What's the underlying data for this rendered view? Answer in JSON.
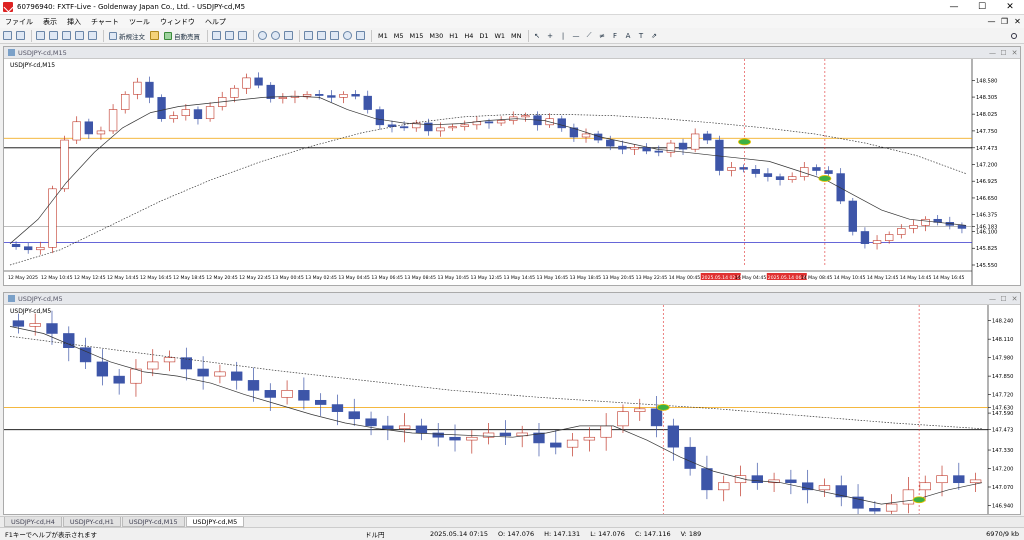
{
  "window": {
    "title": "60796940: FXTF-Live - Goldenway Japan Co., Ltd. - USDJPY-cd,M5",
    "minimize": "—",
    "maximize": "☐",
    "close": "✕"
  },
  "menu": [
    "ファイル",
    "表示",
    "挿入",
    "チャート",
    "ツール",
    "ウィンドウ",
    "ヘルプ"
  ],
  "menu_controls": [
    "—",
    "❐",
    "✕"
  ],
  "toolbar": {
    "new_order": "新規注文",
    "auto_trade": "自動売買",
    "timeframes": [
      "M1",
      "M5",
      "M15",
      "M30",
      "H1",
      "H4",
      "D1",
      "W1",
      "MN"
    ]
  },
  "colors": {
    "bull": "#ffffff",
    "bear": "#3d55a8",
    "bull_top": "#c0392b",
    "ma": "#333333",
    "orange": "#f0a000",
    "blue": "#3333cc",
    "black_line": "#000000",
    "marker": "#3cb043"
  },
  "top_chart": {
    "window_title": "USDJPY-cd,M15",
    "label": "USDJPY-cd,M15",
    "price_labels": [
      "148.580",
      "148.305",
      "148.025",
      "147.750",
      "147.473",
      "147.200",
      "146.925",
      "146.650",
      "146.375",
      "146.183",
      "146.100",
      "145.825",
      "145.550"
    ],
    "orange_level": "147.630",
    "black_level": "147.473",
    "grey_level": "146.183",
    "blue_level": "145.917",
    "time_labels": [
      "12 May 2025",
      "12 May 10:45",
      "12 May 12:45",
      "12 May 14:45",
      "12 May 16:45",
      "12 May 18:45",
      "12 May 20:45",
      "12 May 22:45",
      "13 May 00:45",
      "13 May 02:45",
      "13 May 04:45",
      "13 May 06:45",
      "13 May 08:45",
      "13 May 10:45",
      "13 May 12:45",
      "13 May 14:45",
      "13 May 16:45",
      "13 May 18:45",
      "13 May 20:45",
      "13 May 22:45",
      "14 May 00:45",
      "2025.05.14 02:55",
      "14 May 04:45",
      "2025.05.14 06:40",
      "14 May 08:45",
      "14 May 10:45",
      "14 May 12:45",
      "14 May 14:45",
      "14 May 16:45"
    ],
    "closes": [
      145.85,
      145.8,
      145.84,
      146.8,
      147.6,
      147.9,
      147.7,
      147.75,
      148.1,
      148.35,
      148.55,
      148.3,
      147.95,
      148.0,
      148.1,
      147.95,
      148.15,
      148.3,
      148.45,
      148.62,
      148.5,
      148.28,
      148.3,
      148.32,
      148.35,
      148.33,
      148.3,
      148.35,
      148.32,
      148.1,
      147.85,
      147.82,
      147.8,
      147.88,
      147.75,
      147.8,
      147.82,
      147.85,
      147.9,
      147.88,
      147.92,
      147.98,
      148.0,
      147.85,
      147.95,
      147.8,
      147.65,
      147.7,
      147.6,
      147.5,
      147.45,
      147.48,
      147.42,
      147.4,
      147.55,
      147.45,
      147.7,
      147.6,
      147.1,
      147.15,
      147.12,
      147.05,
      147.0,
      146.95,
      147.0,
      147.15,
      147.1,
      147.05,
      146.6,
      146.1,
      145.9,
      145.95,
      146.05,
      146.15,
      146.2,
      146.3,
      146.25,
      146.2,
      146.15
    ],
    "ma_fast": [
      145.9,
      146.3,
      146.9,
      147.4,
      147.8,
      148.05,
      148.15,
      148.2,
      148.25,
      148.3,
      148.32,
      148.3,
      148.1,
      147.95,
      147.88,
      147.85,
      147.87,
      147.92,
      147.95,
      147.92,
      147.8,
      147.65,
      147.55,
      147.45,
      147.4,
      147.35,
      147.3,
      147.25,
      147.1,
      146.95,
      146.7,
      146.45,
      146.3,
      146.25,
      146.2
    ],
    "ma_slow": [
      145.55,
      145.8,
      146.2,
      146.6,
      146.95,
      147.25,
      147.5,
      147.72,
      147.88,
      147.98,
      148.02,
      148.02,
      148.0,
      147.95,
      147.88,
      147.8,
      147.7,
      147.55,
      147.35,
      147.05
    ],
    "markers": [
      "2025.05.14 02:55",
      "2025.05.14 06:40"
    ]
  },
  "bottom_chart": {
    "window_title": "USDJPY-cd,M5",
    "label": "USDJPY-cd,M5",
    "price_labels": [
      "148.240",
      "148.110",
      "147.980",
      "147.850",
      "147.720",
      "147.630",
      "147.590",
      "147.473",
      "147.330",
      "147.200",
      "147.070",
      "146.940"
    ],
    "orange_level": "147.630",
    "black_level": "147.473",
    "closes": [
      148.2,
      148.22,
      148.15,
      148.05,
      147.95,
      147.85,
      147.8,
      147.9,
      147.95,
      147.98,
      147.9,
      147.85,
      147.88,
      147.82,
      147.75,
      147.7,
      147.75,
      147.68,
      147.65,
      147.6,
      147.55,
      147.5,
      147.48,
      147.5,
      147.45,
      147.42,
      147.4,
      147.42,
      147.45,
      147.43,
      147.45,
      147.38,
      147.35,
      147.4,
      147.42,
      147.5,
      147.6,
      147.62,
      147.5,
      147.35,
      147.2,
      147.05,
      147.1,
      147.15,
      147.1,
      147.12,
      147.1,
      147.05,
      147.08,
      147.0,
      146.92,
      146.9,
      146.95,
      147.05,
      147.1,
      147.15,
      147.1,
      147.12
    ],
    "ma_fast": [
      148.2,
      148.15,
      148.05,
      147.95,
      147.88,
      147.85,
      147.8,
      147.72,
      147.65,
      147.58,
      147.52,
      147.48,
      147.45,
      147.44,
      147.43,
      147.42,
      147.45,
      147.5,
      147.5,
      147.4,
      147.28,
      147.18,
      147.12,
      147.1,
      147.05,
      147.0,
      146.95,
      146.98,
      147.05,
      147.1
    ],
    "ma_slow": [
      148.13,
      148.05,
      147.97,
      147.89,
      147.82,
      147.75,
      147.7,
      147.66,
      147.62,
      147.57,
      147.52,
      147.48
    ],
    "markers": [
      "2025.05.14 02:55",
      "2025.05.14 06:40"
    ]
  },
  "tabs": [
    "USDJPY-cd,H4",
    "USDJPY-cd,H1",
    "USDJPY-cd,M15",
    "USDJPY-cd,M5"
  ],
  "status": {
    "help": "F1キーでヘルプが表示されます",
    "symbol": "ドル円",
    "datetime": "2025.05.14 07:15",
    "open": "O: 147.076",
    "high": "H: 147.131",
    "low": "L: 147.076",
    "close": "C: 147.116",
    "volume": "V: 189",
    "traffic": "6970/9 kb"
  }
}
